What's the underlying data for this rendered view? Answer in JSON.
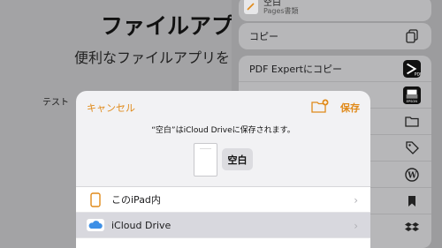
{
  "background": {
    "title": "ファイルアプ",
    "subtitle": "便利なファイルアプリを",
    "side_label": "テスト"
  },
  "share_sheet": {
    "top_app": {
      "title": "空白",
      "subtitle": "Pages書類"
    },
    "copy_label": "コピー",
    "pdf_expert_label": "PDF Expertにコピー",
    "epson_label": "EPSON"
  },
  "modal": {
    "cancel_label": "キャンセル",
    "save_label": "保存",
    "message": "“空白”はiCloud Driveに保存されます。",
    "filename": "空白",
    "locations": [
      {
        "label": "このiPad内",
        "icon": "ipad-icon",
        "selected": false
      },
      {
        "label": "iCloud Drive",
        "icon": "icloud-icon",
        "selected": true
      }
    ]
  },
  "colors": {
    "accent": "#e08a1a",
    "icloud": "#3d8fe6"
  }
}
